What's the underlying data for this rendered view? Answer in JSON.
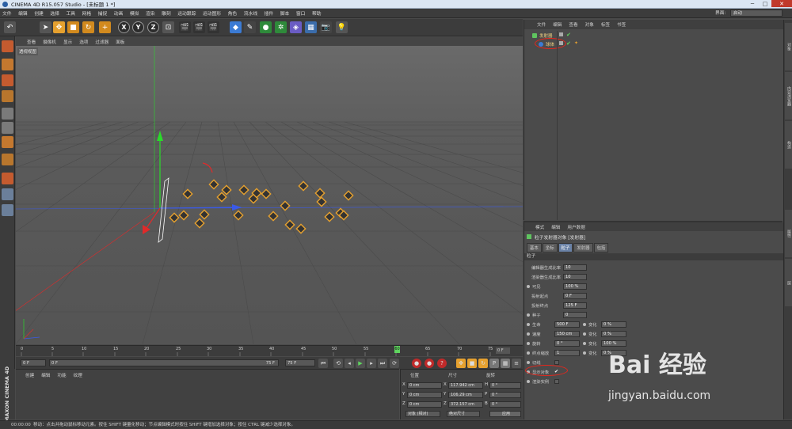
{
  "window": {
    "title": "CINEMA 4D R15.057 Studio - [未标题 1 *]",
    "minimize": "─",
    "maximize": "□",
    "close": "✕"
  },
  "menu": [
    "文件",
    "编辑",
    "创建",
    "选择",
    "工具",
    "网格",
    "捕捉",
    "动画",
    "模拟",
    "渲染",
    "雕刻",
    "运动跟踪",
    "运动图形",
    "角色",
    "流水线",
    "插件",
    "脚本",
    "窗口",
    "帮助"
  ],
  "layout": {
    "label": "界面:",
    "value": "启动"
  },
  "toolbar": {
    "undo_icon": "undo-icon",
    "x": "X",
    "y": "Y",
    "z": "Z"
  },
  "viewport": {
    "menu": [
      "查看",
      "摄像机",
      "显示",
      "选项",
      "过滤器",
      "面板"
    ],
    "label": "透视视图"
  },
  "timeline": {
    "ticks": [
      "0",
      "5",
      "10",
      "15",
      "20",
      "25",
      "30",
      "35",
      "40",
      "45",
      "50",
      "55",
      "60",
      "65",
      "70",
      "75"
    ],
    "end_label": "0 F",
    "current_frame": "60"
  },
  "playback": {
    "start": "0 F",
    "range_start": "0 F",
    "range_end": "75 F",
    "end": "75 F"
  },
  "materials": {
    "menu": [
      "创建",
      "编辑",
      "功能",
      "纹理"
    ]
  },
  "coords": {
    "headers": {
      "position": "位置",
      "size": "尺寸",
      "rotation": "旋转"
    },
    "rows": [
      {
        "axis": "X",
        "pos": "0 cm",
        "size_axis": "X",
        "size": "117.942 cm",
        "rot_axis": "H",
        "rot": "0 °"
      },
      {
        "axis": "Y",
        "pos": "0 cm",
        "size_axis": "Y",
        "size": "106.29 cm",
        "rot_axis": "P",
        "rot": "0 °"
      },
      {
        "axis": "Z",
        "pos": "0 cm",
        "size_axis": "Z",
        "size": "372.157 cm",
        "rot_axis": "B",
        "rot": "0 °"
      }
    ],
    "mode": "对象 (相对)",
    "size_mode": "绝对尺寸",
    "apply": "应用"
  },
  "objects": {
    "menu": [
      "文件",
      "编辑",
      "查看",
      "对象",
      "标签",
      "书签"
    ],
    "items": [
      {
        "name": "发射器",
        "indent": 0
      },
      {
        "name": "球体",
        "indent": 1
      }
    ]
  },
  "attributes": {
    "menu": [
      "模式",
      "编辑",
      "用户数据"
    ],
    "title": "粒子发射器对象 [发射器]",
    "tabs": [
      "基本",
      "坐标",
      "粒子",
      "发射器",
      "包括"
    ],
    "selected_tab": "粒子",
    "section": "粒子",
    "rows": [
      {
        "label": "编辑器生成比率",
        "value": "10"
      },
      {
        "label": "渲染器生成比率",
        "value": "10"
      },
      {
        "label": "可见",
        "value": "100 %"
      },
      {
        "label": "投射起点",
        "value": "0 F"
      },
      {
        "label": "投射终点",
        "value": "125 F"
      },
      {
        "label": "种子",
        "value": "0"
      },
      {
        "label": "生命",
        "value": "500 F",
        "var_label": "变化",
        "var": "0 %"
      },
      {
        "label": "速度",
        "value": "150 cm",
        "var_label": "变化",
        "var": "0 %"
      },
      {
        "label": "旋转",
        "value": "0 °",
        "var_label": "变化",
        "var": "100 %"
      },
      {
        "label": "终点缩放",
        "value": "1",
        "var_label": "变化",
        "var": "0 %"
      }
    ],
    "checks": [
      {
        "label": "切线",
        "value": ""
      },
      {
        "label": "显示对象",
        "value": "✔"
      },
      {
        "label": "渲染实例",
        "value": ""
      }
    ]
  },
  "status": {
    "time": "00:00:00",
    "message": "移动：点击并拖动鼠标移动元素。按住 SHIFT 键量化移动；节点编辑模式时按住 SHIFT 键增加选择对象；按住 CTRL 键减少选择对象。"
  },
  "right_strip": [
    "对象",
    "内容浏览器",
    "构造",
    "属性",
    "层"
  ],
  "maxon_logo": "MAXON CINEMA 4D",
  "watermark": {
    "text": "Bai 经验",
    "url": "jingyan.baidu.com"
  },
  "colors": {
    "accent": "#e6a12f",
    "selected_tab": "#6a82a6",
    "annotation": "#e0281e",
    "x_axis": "#e02a2a",
    "y_axis": "#2adb2a",
    "z_axis": "#3a5ae8"
  }
}
